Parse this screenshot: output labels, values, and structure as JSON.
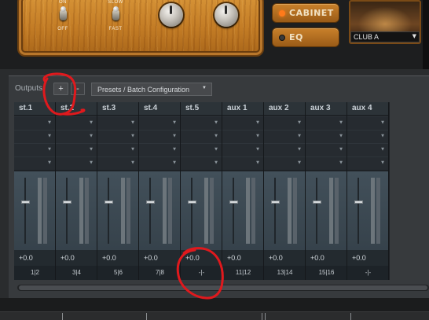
{
  "amp": {
    "switch1": {
      "top": "ON",
      "bottom": "OFF"
    },
    "switch2": {
      "top": "SLOW",
      "bottom": "FAST"
    },
    "cabinet_label": "CABINET",
    "eq_label": "EQ",
    "room_preset": "CLUB A",
    "colors": {
      "cabinet_led": "#ff7a1a",
      "eq_led": "#3a3a3a"
    }
  },
  "toolbar": {
    "outputs_label": "Outputs",
    "add_label": "+",
    "remove_label": "-",
    "presets_label": "Presets / Batch Configuration",
    "presets_arrow": "▼"
  },
  "channels": [
    {
      "name": "st.1",
      "gain": "+0.0",
      "io": "1|2"
    },
    {
      "name": "st.2",
      "gain": "+0.0",
      "io": "3|4"
    },
    {
      "name": "st.3",
      "gain": "+0.0",
      "io": "5|6"
    },
    {
      "name": "st.4",
      "gain": "+0.0",
      "io": "7|8"
    },
    {
      "name": "st.5",
      "gain": "+0.0",
      "io": "-|-"
    },
    {
      "name": "aux 1",
      "gain": "+0.0",
      "io": "11|12"
    },
    {
      "name": "aux 2",
      "gain": "+0.0",
      "io": "13|14"
    },
    {
      "name": "aux 3",
      "gain": "+0.0",
      "io": "15|16"
    },
    {
      "name": "aux 4",
      "gain": "+0.0",
      "io": "-|-"
    }
  ],
  "colors": {
    "annotation": "#e0191d",
    "strip_bg": "#1e2226"
  }
}
